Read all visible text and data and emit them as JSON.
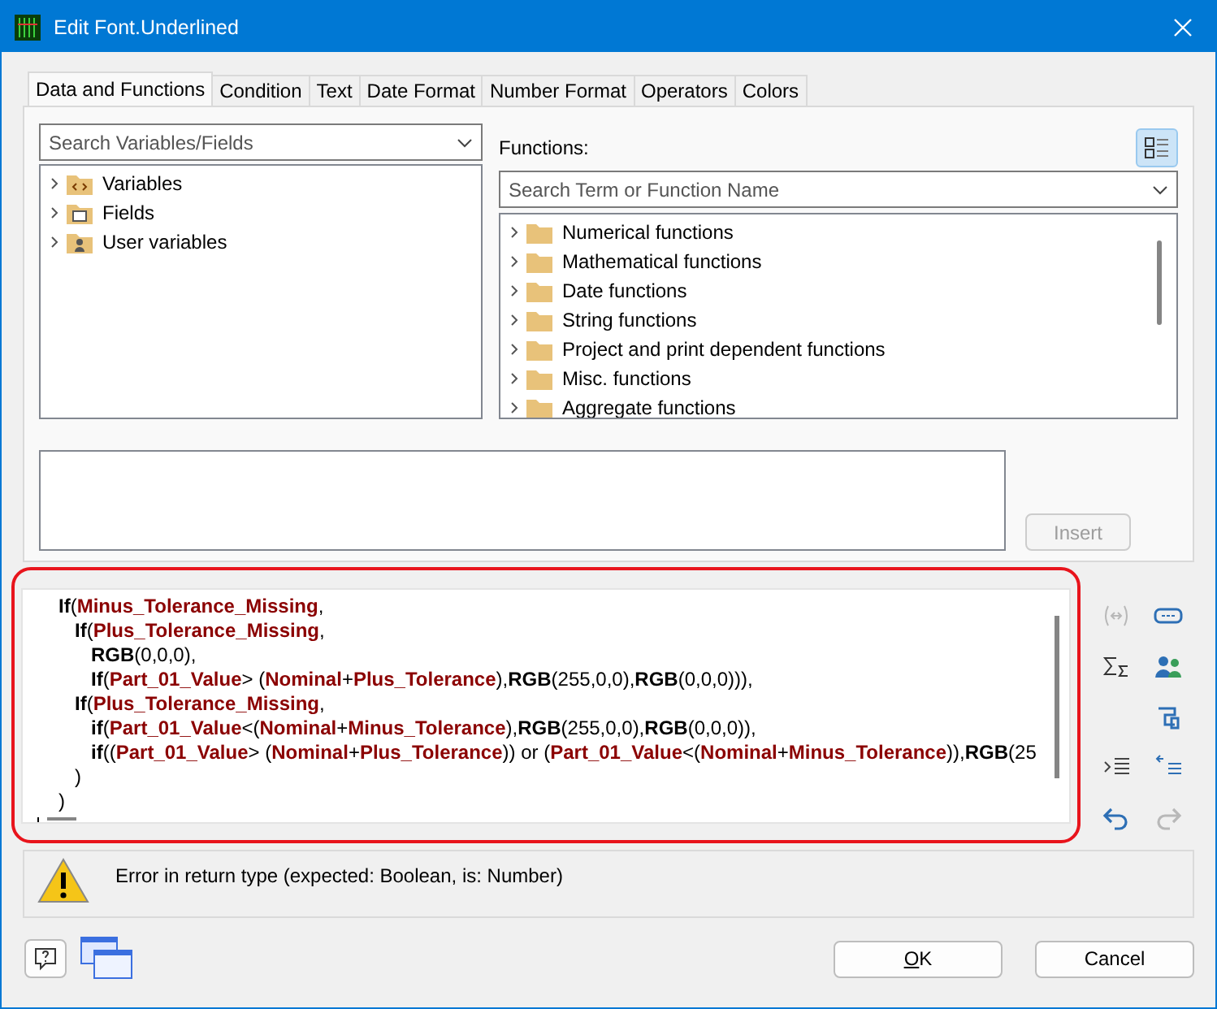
{
  "window": {
    "title": "Edit Font.Underlined"
  },
  "tabs": [
    {
      "label": "Data and Functions",
      "selected": true
    },
    {
      "label": "Condition",
      "selected": false
    },
    {
      "label": "Text",
      "selected": false
    },
    {
      "label": "Date Format",
      "selected": false
    },
    {
      "label": "Number Format",
      "selected": false
    },
    {
      "label": "Operators",
      "selected": false
    },
    {
      "label": "Colors",
      "selected": false
    }
  ],
  "variables": {
    "search_placeholder": "Search Variables/Fields",
    "items": [
      {
        "label": "Variables",
        "kind": "variables",
        "expanded": false
      },
      {
        "label": "Fields",
        "kind": "fields",
        "expanded": false
      },
      {
        "label": "User variables",
        "kind": "user",
        "expanded": false
      }
    ]
  },
  "functions": {
    "label": "Functions:",
    "search_placeholder": "Search Term or Function Name",
    "items": [
      {
        "label": "Numerical functions",
        "expanded": false
      },
      {
        "label": "Mathematical functions",
        "expanded": false
      },
      {
        "label": "Date functions",
        "expanded": false
      },
      {
        "label": "String functions",
        "expanded": false
      },
      {
        "label": "Project and print dependent functions",
        "expanded": false
      },
      {
        "label": "Misc. functions",
        "expanded": false
      },
      {
        "label": "Aggregate functions",
        "expanded": false
      }
    ]
  },
  "insert_button": {
    "label": "Insert",
    "disabled": true
  },
  "editor": {
    "highlighted": true,
    "lines": [
      {
        "tokens": [
          {
            "kind": "keyword",
            "text": "If"
          },
          {
            "kind": "plain",
            "text": "("
          },
          {
            "kind": "field",
            "text": "Minus_Tolerance_Missing"
          },
          {
            "kind": "plain",
            "text": ","
          }
        ],
        "children": [
          {
            "tokens": [
              {
                "kind": "keyword",
                "text": "If"
              },
              {
                "kind": "plain",
                "text": "("
              },
              {
                "kind": "field",
                "text": "Plus_Tolerance_Missing"
              },
              {
                "kind": "plain",
                "text": ","
              }
            ],
            "children": [
              {
                "tokens": [
                  {
                    "kind": "keyword",
                    "text": "RGB"
                  },
                  {
                    "kind": "plain",
                    "text": "(0,0,0),"
                  }
                ]
              },
              {
                "tokens": [
                  {
                    "kind": "keyword",
                    "text": "If"
                  },
                  {
                    "kind": "plain",
                    "text": "("
                  },
                  {
                    "kind": "field",
                    "text": "Part_01_Value"
                  },
                  {
                    "kind": "plain",
                    "text": "> ("
                  },
                  {
                    "kind": "field",
                    "text": "Nominal"
                  },
                  {
                    "kind": "plain",
                    "text": "+"
                  },
                  {
                    "kind": "field",
                    "text": "Plus_Tolerance"
                  },
                  {
                    "kind": "plain",
                    "text": "),"
                  },
                  {
                    "kind": "keyword",
                    "text": "RGB"
                  },
                  {
                    "kind": "plain",
                    "text": "(255,0,0),"
                  },
                  {
                    "kind": "keyword",
                    "text": "RGB"
                  },
                  {
                    "kind": "plain",
                    "text": "(0,0,0))),"
                  }
                ]
              }
            ]
          },
          {
            "tokens": [
              {
                "kind": "keyword",
                "text": "If"
              },
              {
                "kind": "plain",
                "text": "("
              },
              {
                "kind": "field",
                "text": "Plus_Tolerance_Missing"
              },
              {
                "kind": "plain",
                "text": ","
              }
            ],
            "children": [
              {
                "tokens": [
                  {
                    "kind": "keyword",
                    "text": "if"
                  },
                  {
                    "kind": "plain",
                    "text": "("
                  },
                  {
                    "kind": "field",
                    "text": "Part_01_Value"
                  },
                  {
                    "kind": "plain",
                    "text": "<("
                  },
                  {
                    "kind": "field",
                    "text": "Nominal"
                  },
                  {
                    "kind": "plain",
                    "text": "+"
                  },
                  {
                    "kind": "field",
                    "text": "Minus_Tolerance"
                  },
                  {
                    "kind": "plain",
                    "text": "),"
                  },
                  {
                    "kind": "keyword",
                    "text": "RGB"
                  },
                  {
                    "kind": "plain",
                    "text": "(255,0,0),"
                  },
                  {
                    "kind": "keyword",
                    "text": "RGB"
                  },
                  {
                    "kind": "plain",
                    "text": "(0,0,0)),"
                  }
                ]
              },
              {
                "tokens": [
                  {
                    "kind": "keyword",
                    "text": "if"
                  },
                  {
                    "kind": "plain",
                    "text": "(("
                  },
                  {
                    "kind": "field",
                    "text": "Part_01_Value"
                  },
                  {
                    "kind": "plain",
                    "text": "> ("
                  },
                  {
                    "kind": "field",
                    "text": "Nominal"
                  },
                  {
                    "kind": "plain",
                    "text": "+"
                  },
                  {
                    "kind": "field",
                    "text": "Plus_Tolerance"
                  },
                  {
                    "kind": "plain",
                    "text": ")) or ("
                  },
                  {
                    "kind": "field",
                    "text": "Part_01_Value"
                  },
                  {
                    "kind": "plain",
                    "text": "<("
                  },
                  {
                    "kind": "field",
                    "text": "Nominal"
                  },
                  {
                    "kind": "plain",
                    "text": "+"
                  },
                  {
                    "kind": "field",
                    "text": "Minus_Tolerance"
                  },
                  {
                    "kind": "plain",
                    "text": ")),"
                  },
                  {
                    "kind": "keyword",
                    "text": "RGB"
                  },
                  {
                    "kind": "plain",
                    "text": "(25"
                  }
                ]
              }
            ]
          },
          {
            "tokens": [
              {
                "kind": "plain",
                "text": ")"
              }
            ]
          }
        ]
      },
      {
        "tokens": [
          {
            "kind": "plain",
            "text": ")"
          }
        ]
      }
    ]
  },
  "side_tools": [
    {
      "kind": "brackets",
      "disabled": true
    },
    {
      "kind": "field",
      "disabled": false
    },
    {
      "kind": "sum",
      "disabled": false
    },
    {
      "kind": "users",
      "disabled": false
    },
    {
      "kind": "clamp",
      "disabled": false
    },
    {
      "kind": "indent",
      "disabled": false
    },
    {
      "kind": "outdent",
      "disabled": false
    },
    {
      "kind": "undo",
      "disabled": false
    },
    {
      "kind": "redo",
      "disabled": true
    }
  ],
  "message": {
    "text": "Error in return type (expected: Boolean, is: Number)"
  },
  "buttons": [
    {
      "label": "OK",
      "mnemonic": true
    },
    {
      "label": "Cancel",
      "mnemonic": false
    }
  ]
}
